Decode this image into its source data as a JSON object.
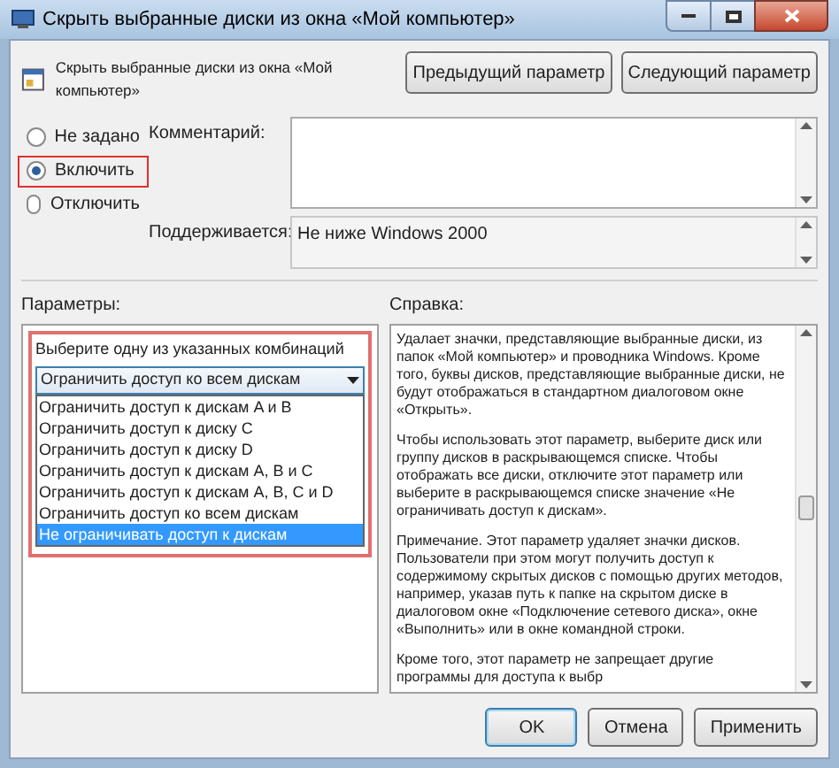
{
  "window": {
    "title": "Скрыть выбранные диски из окна «Мой компьютер»"
  },
  "header": {
    "title": "Скрыть выбранные диски из окна «Мой компьютер»",
    "buttons": [
      "Предыдущий параметр",
      "Следующий параметр"
    ]
  },
  "state_options": [
    {
      "label": "Не задано",
      "selected": false
    },
    {
      "label": "Включить",
      "selected": true
    },
    {
      "label": "Отключить",
      "selected": false
    }
  ],
  "comment": {
    "label": "Комментарий:"
  },
  "supported": {
    "label": "Поддерживается:",
    "value": "Не ниже Windows 2000"
  },
  "parameters": {
    "label": "Параметры:",
    "prompt": "Выберите одну из указанных комбинаций",
    "value": "Ограничить доступ ко всем дискам",
    "expanded": true,
    "options": [
      {
        "label": "Ограничить доступ к дискам A и B",
        "highlighted": false
      },
      {
        "label": "Ограничить доступ к диску C",
        "highlighted": false
      },
      {
        "label": "Ограничить доступ к диску D",
        "highlighted": false
      },
      {
        "label": "Ограничить доступ к дискам A, B и C",
        "highlighted": false
      },
      {
        "label": "Ограничить доступ к дискам A, B, C и D",
        "highlighted": false
      },
      {
        "label": "Ограничить доступ ко всем дискам",
        "highlighted": false
      },
      {
        "label": "Не ограничивать доступ к дискам",
        "highlighted": true
      }
    ]
  },
  "help": {
    "label": "Справка:",
    "paragraphs": [
      "Удалает значки, представляющие выбранные диски, из папок «Мой компьютер» и проводника Windows.  Кроме того, буквы дисков, представляющие выбранные диски, не будут отображаться в стандартном диалоговом окне «Открыть».",
      "Чтобы использовать этот параметр, выберите диск или группу дисков в раскрывающемся списке.  Чтобы отображать все диски, отключите этот параметр или выберите в раскрывающемся списке значение «Не ограничивать доступ к дискам».",
      "Примечание. Этот параметр удаляет значки дисков. Пользователи при этом могут получить доступ к содержимому скрытых дисков с помощью других методов, например, указав путь к папке на скрытом диске в диалоговом окне «Подключение сетевого диска», окне «Выполнить» или в окне командной строки.",
      "Кроме того, этот параметр не запрещает другие программы для доступа к выбр"
    ]
  },
  "footer": {
    "buttons": [
      {
        "label": "OK",
        "kind": "default"
      },
      {
        "label": "Отмена",
        "kind": "normal"
      },
      {
        "label": "Применить",
        "kind": "normal"
      }
    ]
  }
}
